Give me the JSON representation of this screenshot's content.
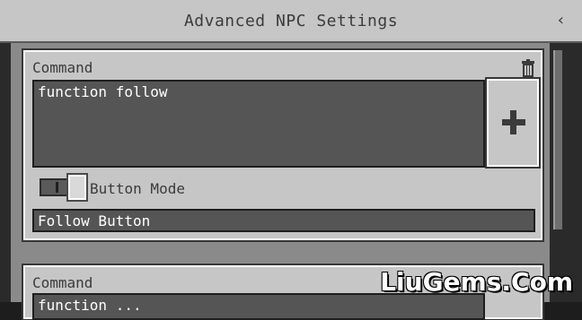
{
  "window": {
    "title": "Advanced NPC Settings",
    "back_icon": "chevron-left-icon"
  },
  "commands": [
    {
      "label": "Command",
      "delete_icon": "trash-icon",
      "command_text": "function follow",
      "add_icon": "plus-icon",
      "toggle_label": "Button Mode",
      "toggle_on": true,
      "button_name": "Follow Button"
    },
    {
      "label": "Command",
      "command_text": "function ..."
    }
  ],
  "watermark": "LiuGems.Com",
  "colors": {
    "panel": "#c6c6c6",
    "field": "#555555",
    "background": "#8a8a8a"
  }
}
